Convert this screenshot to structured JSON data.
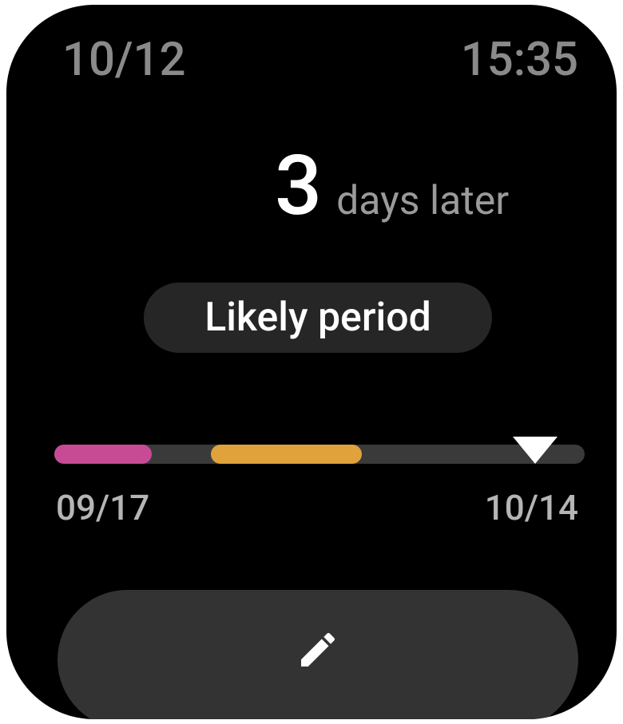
{
  "status_bar": {
    "date": "10/12",
    "time": "15:35"
  },
  "prediction": {
    "days_value": "3",
    "days_unit": "days later",
    "phase_label": "Likely period"
  },
  "cycle_bar": {
    "start_date": "09/17",
    "end_date": "10/14",
    "today_position": 0.907,
    "segments": [
      {
        "kind": "period",
        "start": 0.0,
        "end": 0.183,
        "color": "#c64b94"
      },
      {
        "kind": "fertile",
        "start": 0.295,
        "end": 0.58,
        "color": "#e0a23a"
      }
    ],
    "track_color": "#3a3a3a",
    "marker_color": "#ffffff"
  },
  "actions": {
    "edit_icon": "pencil-icon"
  }
}
